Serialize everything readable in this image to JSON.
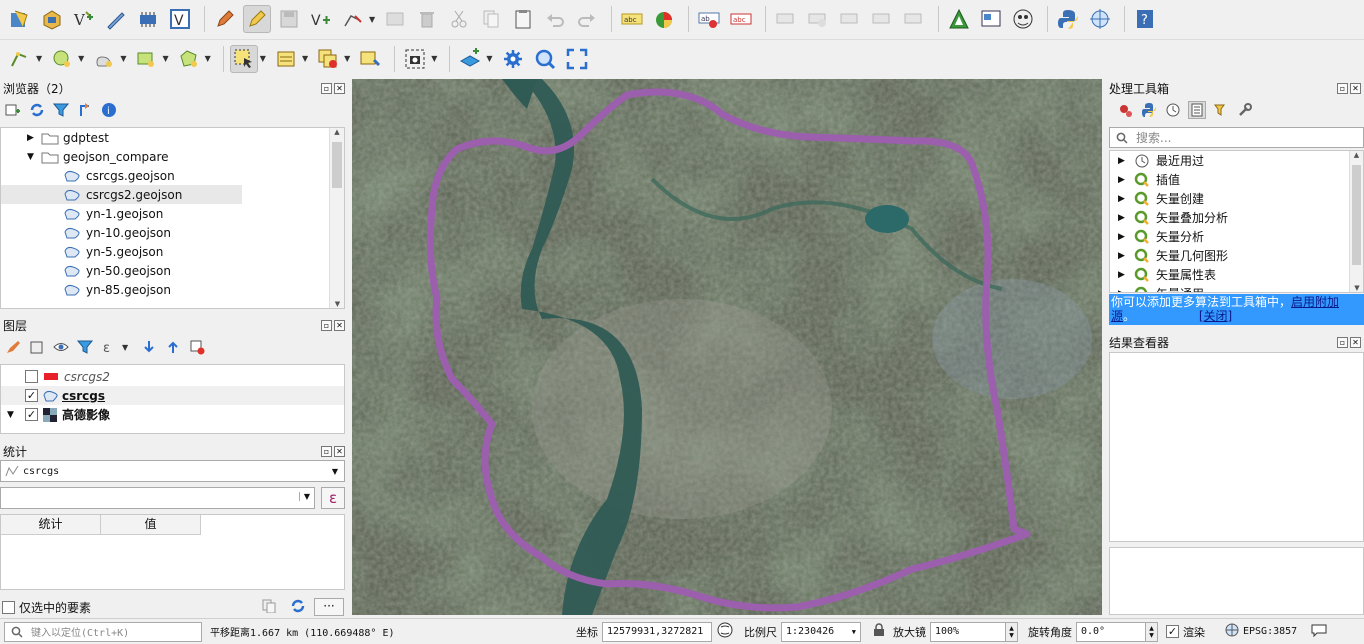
{
  "browser": {
    "title": "浏览器（2）",
    "items": [
      {
        "label": "gdptest",
        "type": "folder"
      },
      {
        "label": "geojson_compare",
        "type": "folder-open"
      },
      {
        "label": "csrcgs.geojson",
        "type": "file"
      },
      {
        "label": "csrcgs2.geojson",
        "type": "file"
      },
      {
        "label": "yn-1.geojson",
        "type": "file"
      },
      {
        "label": "yn-10.geojson",
        "type": "file"
      },
      {
        "label": "yn-5.geojson",
        "type": "file"
      },
      {
        "label": "yn-50.geojson",
        "type": "file"
      },
      {
        "label": "yn-85.geojson",
        "type": "file"
      }
    ]
  },
  "layers": {
    "title": "图层",
    "items": [
      {
        "label": "csrcgs2",
        "checked": false
      },
      {
        "label": "csrcgs",
        "checked": true
      },
      {
        "label": "高德影像",
        "checked": true
      }
    ]
  },
  "stats": {
    "title": "统计",
    "layer": "csrcgs",
    "col_stat": "统计",
    "col_value": "值",
    "only_selected": "仅选中的要素",
    "epsilon": "ε"
  },
  "toolbox": {
    "title": "处理工具箱",
    "search_placeholder": "搜索...",
    "items": [
      {
        "label": "最近用过",
        "icon": "clock"
      },
      {
        "label": "插值",
        "icon": "q"
      },
      {
        "label": "矢量创建",
        "icon": "q"
      },
      {
        "label": "矢量叠加分析",
        "icon": "q"
      },
      {
        "label": "矢量分析",
        "icon": "q"
      },
      {
        "label": "矢量几何图形",
        "icon": "q"
      },
      {
        "label": "矢量属性表",
        "icon": "q"
      },
      {
        "label": "矢量通用",
        "icon": "q"
      }
    ],
    "banner_text": "你可以添加更多算法到工具箱中，",
    "banner_link": "启用附加源",
    "banner_text2": "。",
    "banner_close": "[关闭]"
  },
  "results": {
    "title": "结果查看器"
  },
  "status": {
    "locate_placeholder": "键入以定位(Ctrl+K)",
    "message": "平移距离1.667 km (110.669488° E)",
    "coord_label": "坐标",
    "coord_value": "12579931,3272821",
    "scale_label": "比例尺",
    "scale_value": "1:230426",
    "magnifier_label": "放大镜",
    "magnifier_value": "100%",
    "rotation_label": "旋转角度",
    "rotation_value": "0.0°",
    "render_label": "渲染",
    "crs": "EPSG:3857"
  },
  "colors": {
    "boundary": "#9b5fad",
    "banner_bg": "#3399ff"
  }
}
